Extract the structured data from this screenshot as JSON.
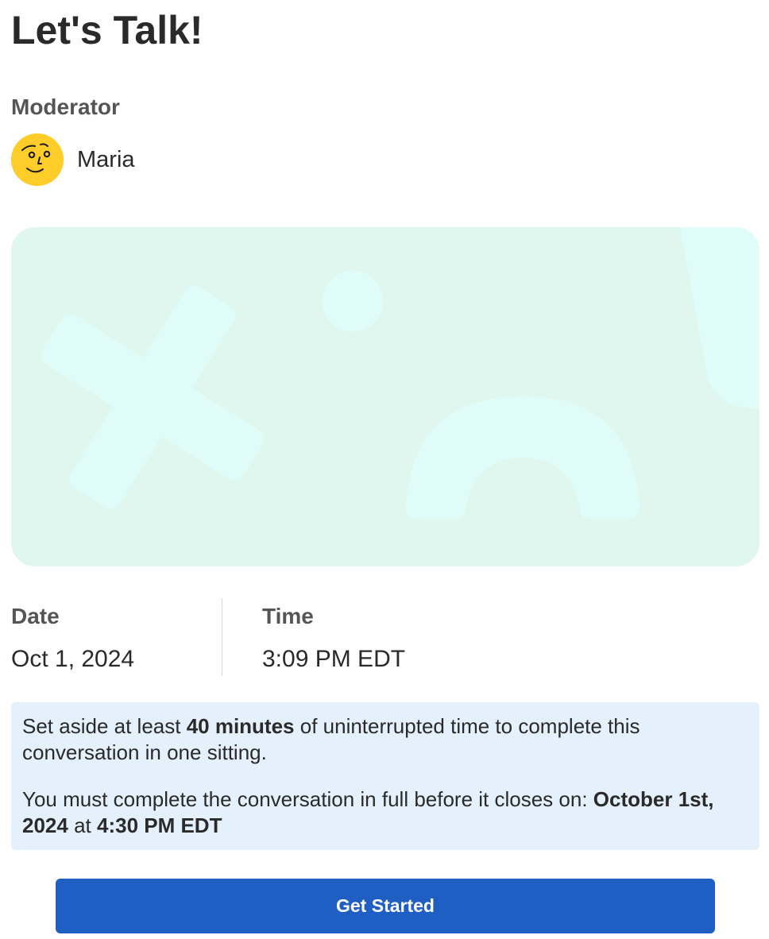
{
  "page": {
    "title": "Let's Talk!"
  },
  "moderator": {
    "heading": "Moderator",
    "name": "Maria",
    "avatar_icon": "doodle-face-avatar",
    "avatar_color": "#ffcd29"
  },
  "banner": {
    "background_color": "#e0f7ef",
    "shape_color": "#e0fcf8",
    "shapes": [
      "x-shape",
      "circle",
      "arch",
      "exclamation-bar"
    ]
  },
  "schedule": {
    "date_label": "Date",
    "date_value": "Oct 1, 2024",
    "time_label": "Time",
    "time_value": "3:09 PM EDT"
  },
  "notice": {
    "line1_pre": "Set aside at least ",
    "line1_bold": "40 minutes",
    "line1_post": " of uninterrupted time to complete this conversation in one sitting.",
    "line2_pre": "You must complete the conversation in full before it closes on: ",
    "line2_date": "October 1st, 2024",
    "line2_mid": " at ",
    "line2_time": "4:30 PM EDT",
    "background_color": "#e4f0fb"
  },
  "actions": {
    "get_started_label": "Get Started",
    "accent_color": "#1f5fc4"
  }
}
